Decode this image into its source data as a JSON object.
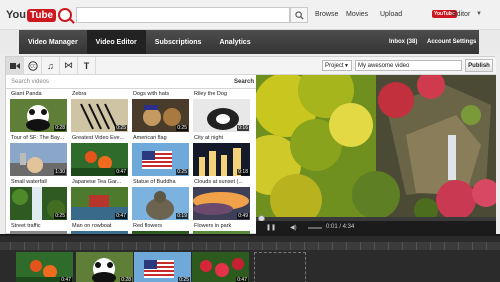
{
  "header": {
    "logo_you": "You",
    "logo_tube": "Tube",
    "search_placeholder": "",
    "links": [
      "Browse",
      "Movies",
      "Upload"
    ],
    "account_logo": "YouTube",
    "account_name": "Editor"
  },
  "nav": {
    "tabs": [
      "Video Manager",
      "Video Editor",
      "Subscriptions",
      "Analytics"
    ],
    "active_tab": "Video Editor",
    "inbox": "Inbox (38)",
    "account_settings": "Account Settings"
  },
  "tools": [
    "camera-icon",
    "cc-icon",
    "music-icon",
    "transition-icon",
    "text-icon"
  ],
  "library": {
    "search_placeholder": "Search videos",
    "search_button": "Search",
    "videos": [
      {
        "title": "Giant Panda",
        "duration": "0:28"
      },
      {
        "title": "Zebra",
        "duration": "0:25"
      },
      {
        "title": "Dogs with hats",
        "duration": "0:25"
      },
      {
        "title": "Riley the Dog",
        "duration": "0:16"
      },
      {
        "title": "Tour of SF: The Bay...",
        "duration": "1:30"
      },
      {
        "title": "Greatest Video Eve...",
        "duration": "0:47"
      },
      {
        "title": "American flag",
        "duration": "0:25"
      },
      {
        "title": "City at night",
        "duration": "0:18"
      },
      {
        "title": "Small waterfall",
        "duration": "0:25"
      },
      {
        "title": "Japanese Tea Gar...",
        "duration": "0:47"
      },
      {
        "title": "Statue of Buddha",
        "duration": "0:19"
      },
      {
        "title": "Clouds at sunset (...",
        "duration": "0:49"
      },
      {
        "title": "Street traffic",
        "duration": ""
      },
      {
        "title": "Man on rowboat",
        "duration": ""
      },
      {
        "title": "Red flowers",
        "duration": ""
      },
      {
        "title": "Flowers in park",
        "duration": ""
      }
    ]
  },
  "project": {
    "select_label": "Project",
    "name": "My awesome video",
    "publish": "Publish"
  },
  "player": {
    "time": "0:01 / 4:34"
  },
  "timeline": {
    "clips": [
      {
        "duration": "0:47"
      },
      {
        "duration": "0:28"
      },
      {
        "duration": "0:25"
      },
      {
        "duration": "0:47"
      }
    ]
  }
}
